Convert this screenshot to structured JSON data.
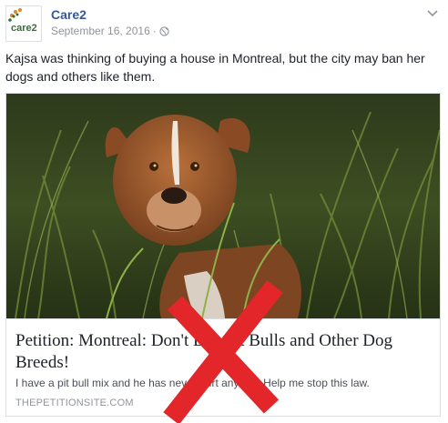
{
  "post": {
    "page_name": "Care2",
    "date": "September 16, 2016",
    "separator": "·",
    "audience_icon": "globe-icon",
    "options_icon": "chevron-down-icon",
    "text": "Kajsa was thinking of buying a house in Montreal, but the city may ban her dogs and others like them."
  },
  "avatar": {
    "logo_text": "care2",
    "logo_color": "#3a6f3a"
  },
  "link_card": {
    "title": "Petition: Montreal: Don't Ban Pit Bulls and Other Dog Breeds!",
    "description": "I have a pit bull mix and he has never hurt anyone! Help me stop this law.",
    "domain": "THEPETITIONSITE.COM"
  },
  "overlay": {
    "mark_color": "#e3262a"
  }
}
